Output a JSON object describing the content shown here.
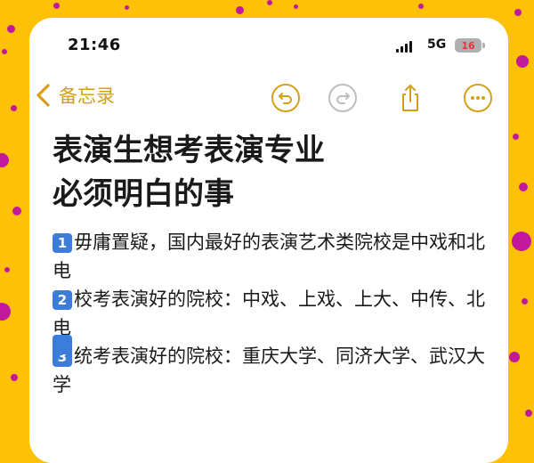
{
  "status_bar": {
    "time": "21:46",
    "network": "5G",
    "battery": "16"
  },
  "nav": {
    "back_label": "备忘录",
    "icons": [
      "undo-icon",
      "redo-icon",
      "share-icon",
      "more-icon"
    ]
  },
  "note": {
    "title_line1": "表演生想考表演专业",
    "title_line2": "必须明白的事",
    "items": [
      {
        "num": "1",
        "text": "毋庸置疑，国内最好的表演艺术类院校是中戏和北电"
      },
      {
        "num": "2",
        "text": "校考表演好的院校：中戏、上戏、上大、中传、北电"
      },
      {
        "num": "3",
        "text": "统考表演好的院校：重庆大学、同济大学、武汉大学"
      }
    ]
  },
  "colors": {
    "background": "#FFC107",
    "dots": "#C2189B",
    "accent": "#D4A017",
    "badge": "#3B7DD8"
  }
}
